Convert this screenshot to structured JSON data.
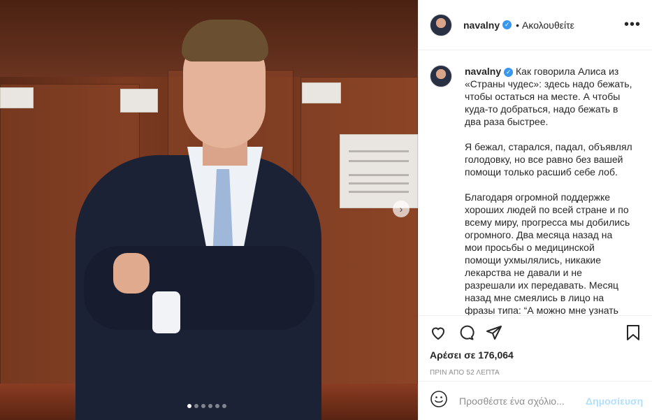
{
  "post": {
    "username": "navalny",
    "verified": true,
    "follow_state": "Ακολουθείτε",
    "more_icon": "more-options-icon",
    "caption_paragraphs": [
      "Как говорила Алиса из «Страны чудес»: здесь надо бежать, чтобы остаться на месте. А чтобы куда-то добраться, надо бежать в два раза быстрее.",
      "Я бежал, старался, падал, объявлял голодовку, но все равно без вашей помощи только расшиб себе лоб.",
      "Благодаря огромной поддержке хороших людей по всей стране и по всему миру, прогресса мы добились огромного. Два месяца назад на мои просьбы о медицинской помощи ухмылялись, никакие лекарства не давали и не разрешали их передавать. Месяц назад мне смеялись в лицо на фразы типа: “А можно мне узнать мой диагноз?” и"
    ],
    "likes": "Αρέσει σε 176,064",
    "time": "ΠΡΙΝ ΑΠΟ 52 ΛΕΠΤΑ"
  },
  "carousel": {
    "total": 6,
    "active": 0,
    "next_icon": "chevron-right-icon"
  },
  "comment_box": {
    "placeholder": "Προσθέστε ένα σχόλιο...",
    "post_label": "Δημοσίευση",
    "emoji_icon": "emoji-icon"
  },
  "colors": {
    "verified": "#3897f0",
    "post_button_disabled": "#b2dffc"
  }
}
